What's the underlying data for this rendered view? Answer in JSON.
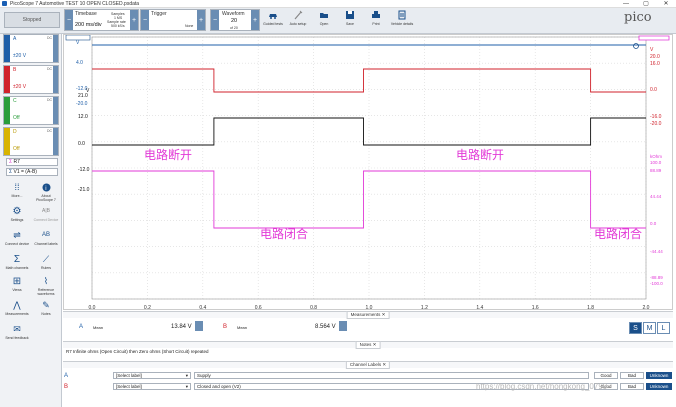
{
  "window": {
    "title": "PicoScope 7 Automotive TEST 10 OPEN CLOSED.psdata",
    "min": "—",
    "max": "▢",
    "close": "✕"
  },
  "toolbar": {
    "status": "Stopped",
    "timebase": {
      "label": "Timebase",
      "value": "200 ms/div",
      "samples_label": "Samples",
      "samples": "1 MS",
      "rate_label": "Sample rate",
      "rate": "500 kS/s"
    },
    "trigger": {
      "label": "Trigger",
      "mode": "None"
    },
    "waveform": {
      "label": "Waveform",
      "value": "20",
      "of": "of 20"
    },
    "buttons": [
      {
        "id": "guided",
        "label": "Guided tests"
      },
      {
        "id": "autosetup",
        "label": "Auto setup"
      },
      {
        "id": "open",
        "label": "Open"
      },
      {
        "id": "save",
        "label": "Save"
      },
      {
        "id": "print",
        "label": "Print"
      },
      {
        "id": "vehicle",
        "label": "Vehicle details"
      }
    ],
    "logo": "pico"
  },
  "channels": [
    {
      "name": "A",
      "coupling": "DC",
      "range": "±20 V",
      "color": "#1f5fa8"
    },
    {
      "name": "B",
      "coupling": "DC",
      "range": "±20 V",
      "color": "#d0212b"
    },
    {
      "name": "C",
      "coupling": "DC",
      "range": "Off",
      "color": "#2a9d3b"
    },
    {
      "name": "D",
      "coupling": "DC",
      "range": "Off",
      "color": "#d8b300"
    }
  ],
  "math": [
    {
      "label": "R7"
    },
    {
      "label": "V1 = (A-B)"
    }
  ],
  "side_buttons": [
    {
      "id": "more",
      "label": "More..."
    },
    {
      "id": "about",
      "label": "About PicoScope 7"
    },
    {
      "id": "settings",
      "label": "Settings"
    },
    {
      "id": "connect",
      "label": "Connect Device"
    },
    {
      "id": "connectdev",
      "label": "Connect device"
    },
    {
      "id": "chlabel",
      "label": "Channel labels"
    },
    {
      "id": "mathch",
      "label": "Math channels"
    },
    {
      "id": "rulers",
      "label": "Rulers"
    },
    {
      "id": "views",
      "label": "Views"
    },
    {
      "id": "reference",
      "label": "Reference waveforms"
    },
    {
      "id": "measurements",
      "label": "Measurements"
    },
    {
      "id": "notes",
      "label": "Notes"
    },
    {
      "id": "feedback",
      "label": "Send feedback"
    }
  ],
  "plot": {
    "left_axis_blue": [
      "V",
      "4.0",
      "-12.0",
      "-20.0"
    ],
    "left_axis_black": [
      "V",
      "21.0",
      "12.0",
      "0.0",
      "-12.0",
      "-21.0"
    ],
    "right_axis_red": [
      "V",
      "20.0",
      "16.0",
      "0.0",
      "-16.0",
      "-20.0"
    ],
    "right_axis_pink": [
      "kOhm",
      "100.0",
      "88.89",
      "44.44",
      "0.0",
      "-44.44",
      "-88.89",
      "-100.0"
    ],
    "x_ticks": [
      "0.0",
      "0.2",
      "0.4",
      "0.6",
      "0.8",
      "1.0",
      "1.2",
      "1.4",
      "1.6",
      "1.8",
      "2.0"
    ],
    "annotations": [
      "电路断开",
      "电路断开",
      "电路闭合",
      "电路闭合"
    ],
    "colors": {
      "blue": "#1f5fa8",
      "red": "#d0212b",
      "black": "#111111",
      "pink": "#e23ad7"
    }
  },
  "chart_data": {
    "type": "line",
    "x": [
      0.0,
      0.44,
      0.44,
      0.98,
      0.98,
      1.8,
      1.8,
      2.0
    ],
    "series": [
      {
        "values": [
          4.0,
          4.0,
          4.0,
          4.0,
          4.0,
          4.0,
          4.0,
          4.0
        ]
      },
      {
        "values": [
          16.0,
          16.0,
          0.0,
          0.0,
          16.0,
          16.0,
          0.0,
          0.0
        ]
      },
      {
        "values": [
          0.0,
          0.0,
          12.0,
          12.0,
          0.0,
          0.0,
          12.0,
          12.0
        ]
      },
      {
        "values": [
          0.0,
          0.0,
          -100.0,
          -100.0,
          0.0,
          0.0,
          -100.0,
          -100.0
        ]
      }
    ],
    "xlim": [
      0,
      2.0
    ]
  },
  "measurements": {
    "title": "Measurements",
    "a_ch": "A",
    "a_type": "Mean",
    "a_val": "13.84 V",
    "b_ch": "B",
    "b_type": "Mean",
    "b_val": "8.564 V",
    "s": "S",
    "m": "M",
    "l": "L"
  },
  "notes": {
    "title": "Notes",
    "text": "R7 Infinite ohms (Open Circuit) then Zero ohms (Short Circuit) repeated"
  },
  "labels": {
    "title": "Channel Labels",
    "rows": [
      {
        "ch": "A",
        "select": "[Select label]",
        "text": "Supply",
        "good": "Good",
        "bad": "Bad",
        "unk": "Unknown"
      },
      {
        "ch": "B",
        "select": "[Select label]",
        "text": "Closed and open  (V2)",
        "good": "Good",
        "bad": "Bad",
        "unk": "Unknown"
      }
    ]
  },
  "watermark": "https://blog.csdn.net/hongkong_0799"
}
